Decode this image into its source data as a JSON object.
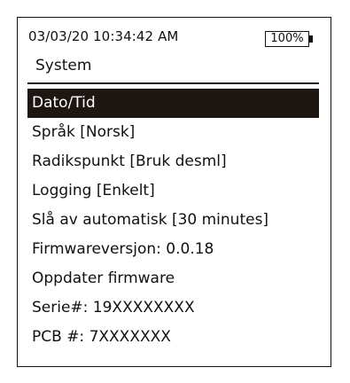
{
  "status": {
    "datetime": "03/03/20 10:34:42 AM",
    "battery": "100%"
  },
  "section_title": "System",
  "menu": {
    "items": [
      {
        "label": "Dato/Tid",
        "selected": true
      },
      {
        "label": "Språk [Norsk]",
        "selected": false
      },
      {
        "label": "Radikspunkt [Bruk desml]",
        "selected": false
      },
      {
        "label": "Logging [Enkelt]",
        "selected": false
      },
      {
        "label": "Slå av automatisk [30 minutes]",
        "selected": false
      },
      {
        "label": "Firmwareversjon: 0.0.18",
        "selected": false
      },
      {
        "label": "Oppdater firmware",
        "selected": false
      },
      {
        "label": "Serie#: 19XXXXXXXX",
        "selected": false
      },
      {
        "label": "PCB #: 7XXXXXXX",
        "selected": false
      }
    ]
  },
  "colors": {
    "highlight": "#1e1612",
    "text": "#111111",
    "background": "#ffffff"
  }
}
